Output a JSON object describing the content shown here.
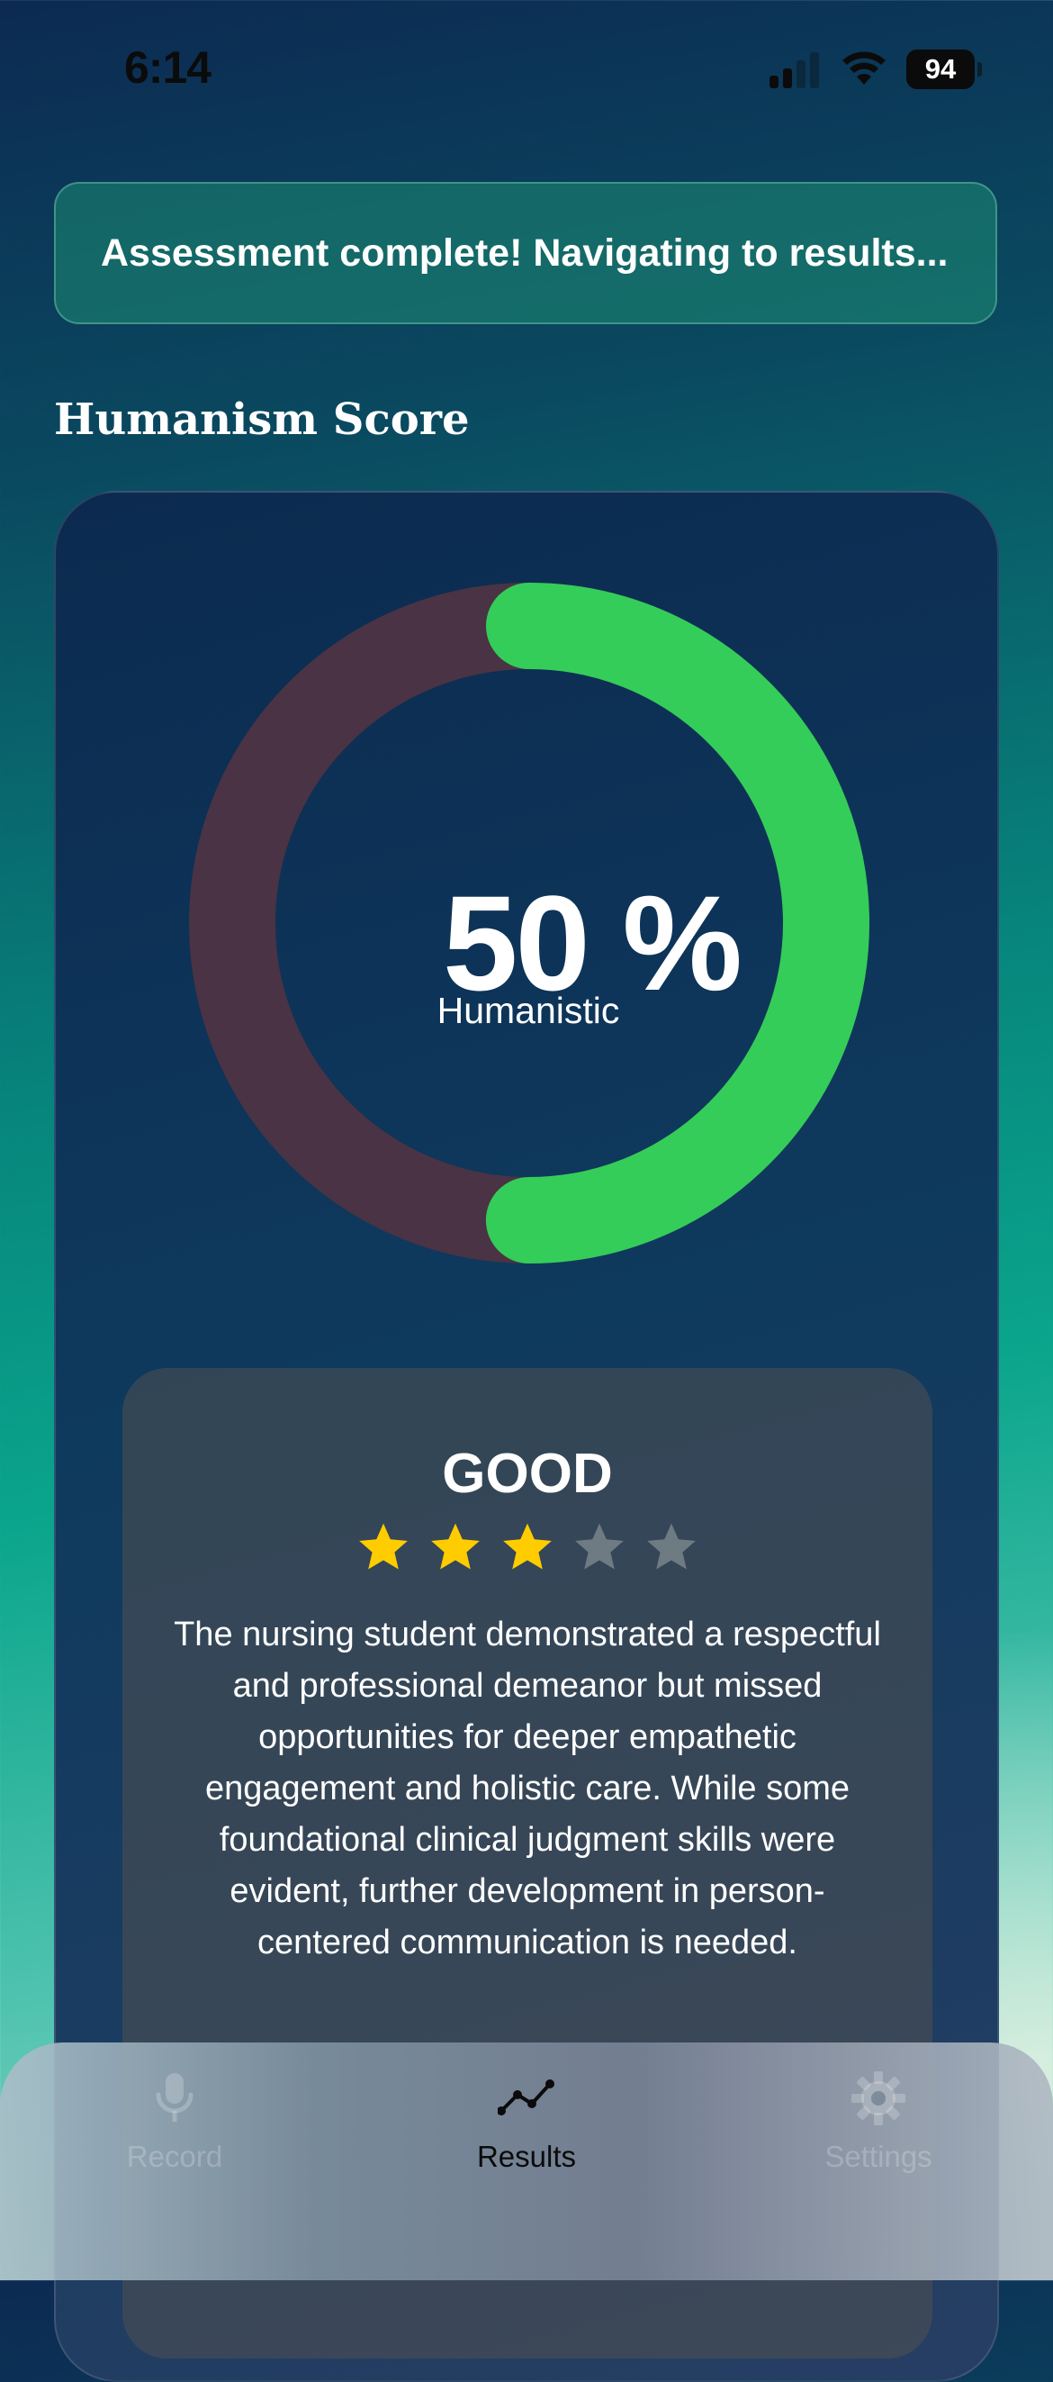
{
  "status_bar": {
    "time": "6:14",
    "battery": "94"
  },
  "banner": {
    "message": "Assessment complete! Navigating to results..."
  },
  "section_title": "Humanism Score",
  "score": {
    "value_text": "50 %",
    "label": "Humanistic",
    "fraction": 0.5,
    "ring_track_color": "#4a3344",
    "ring_fill_color": "#34cd59"
  },
  "rating": {
    "grade": "GOOD",
    "stars_filled": 3,
    "stars_total": 5,
    "star_color": "#ffcc00",
    "description": "The nursing student demonstrated a respectful and professional demeanor but missed opportunities for deeper empathetic engagement and holistic care. While some foundational clinical judgment skills were evident, further development in person-centered communication is needed."
  },
  "tab_bar": {
    "items": [
      {
        "label": "Record",
        "icon": "microphone-icon",
        "active": false
      },
      {
        "label": "Results",
        "icon": "line-chart-icon",
        "active": true
      },
      {
        "label": "Settings",
        "icon": "gear-icon",
        "active": false
      }
    ]
  }
}
